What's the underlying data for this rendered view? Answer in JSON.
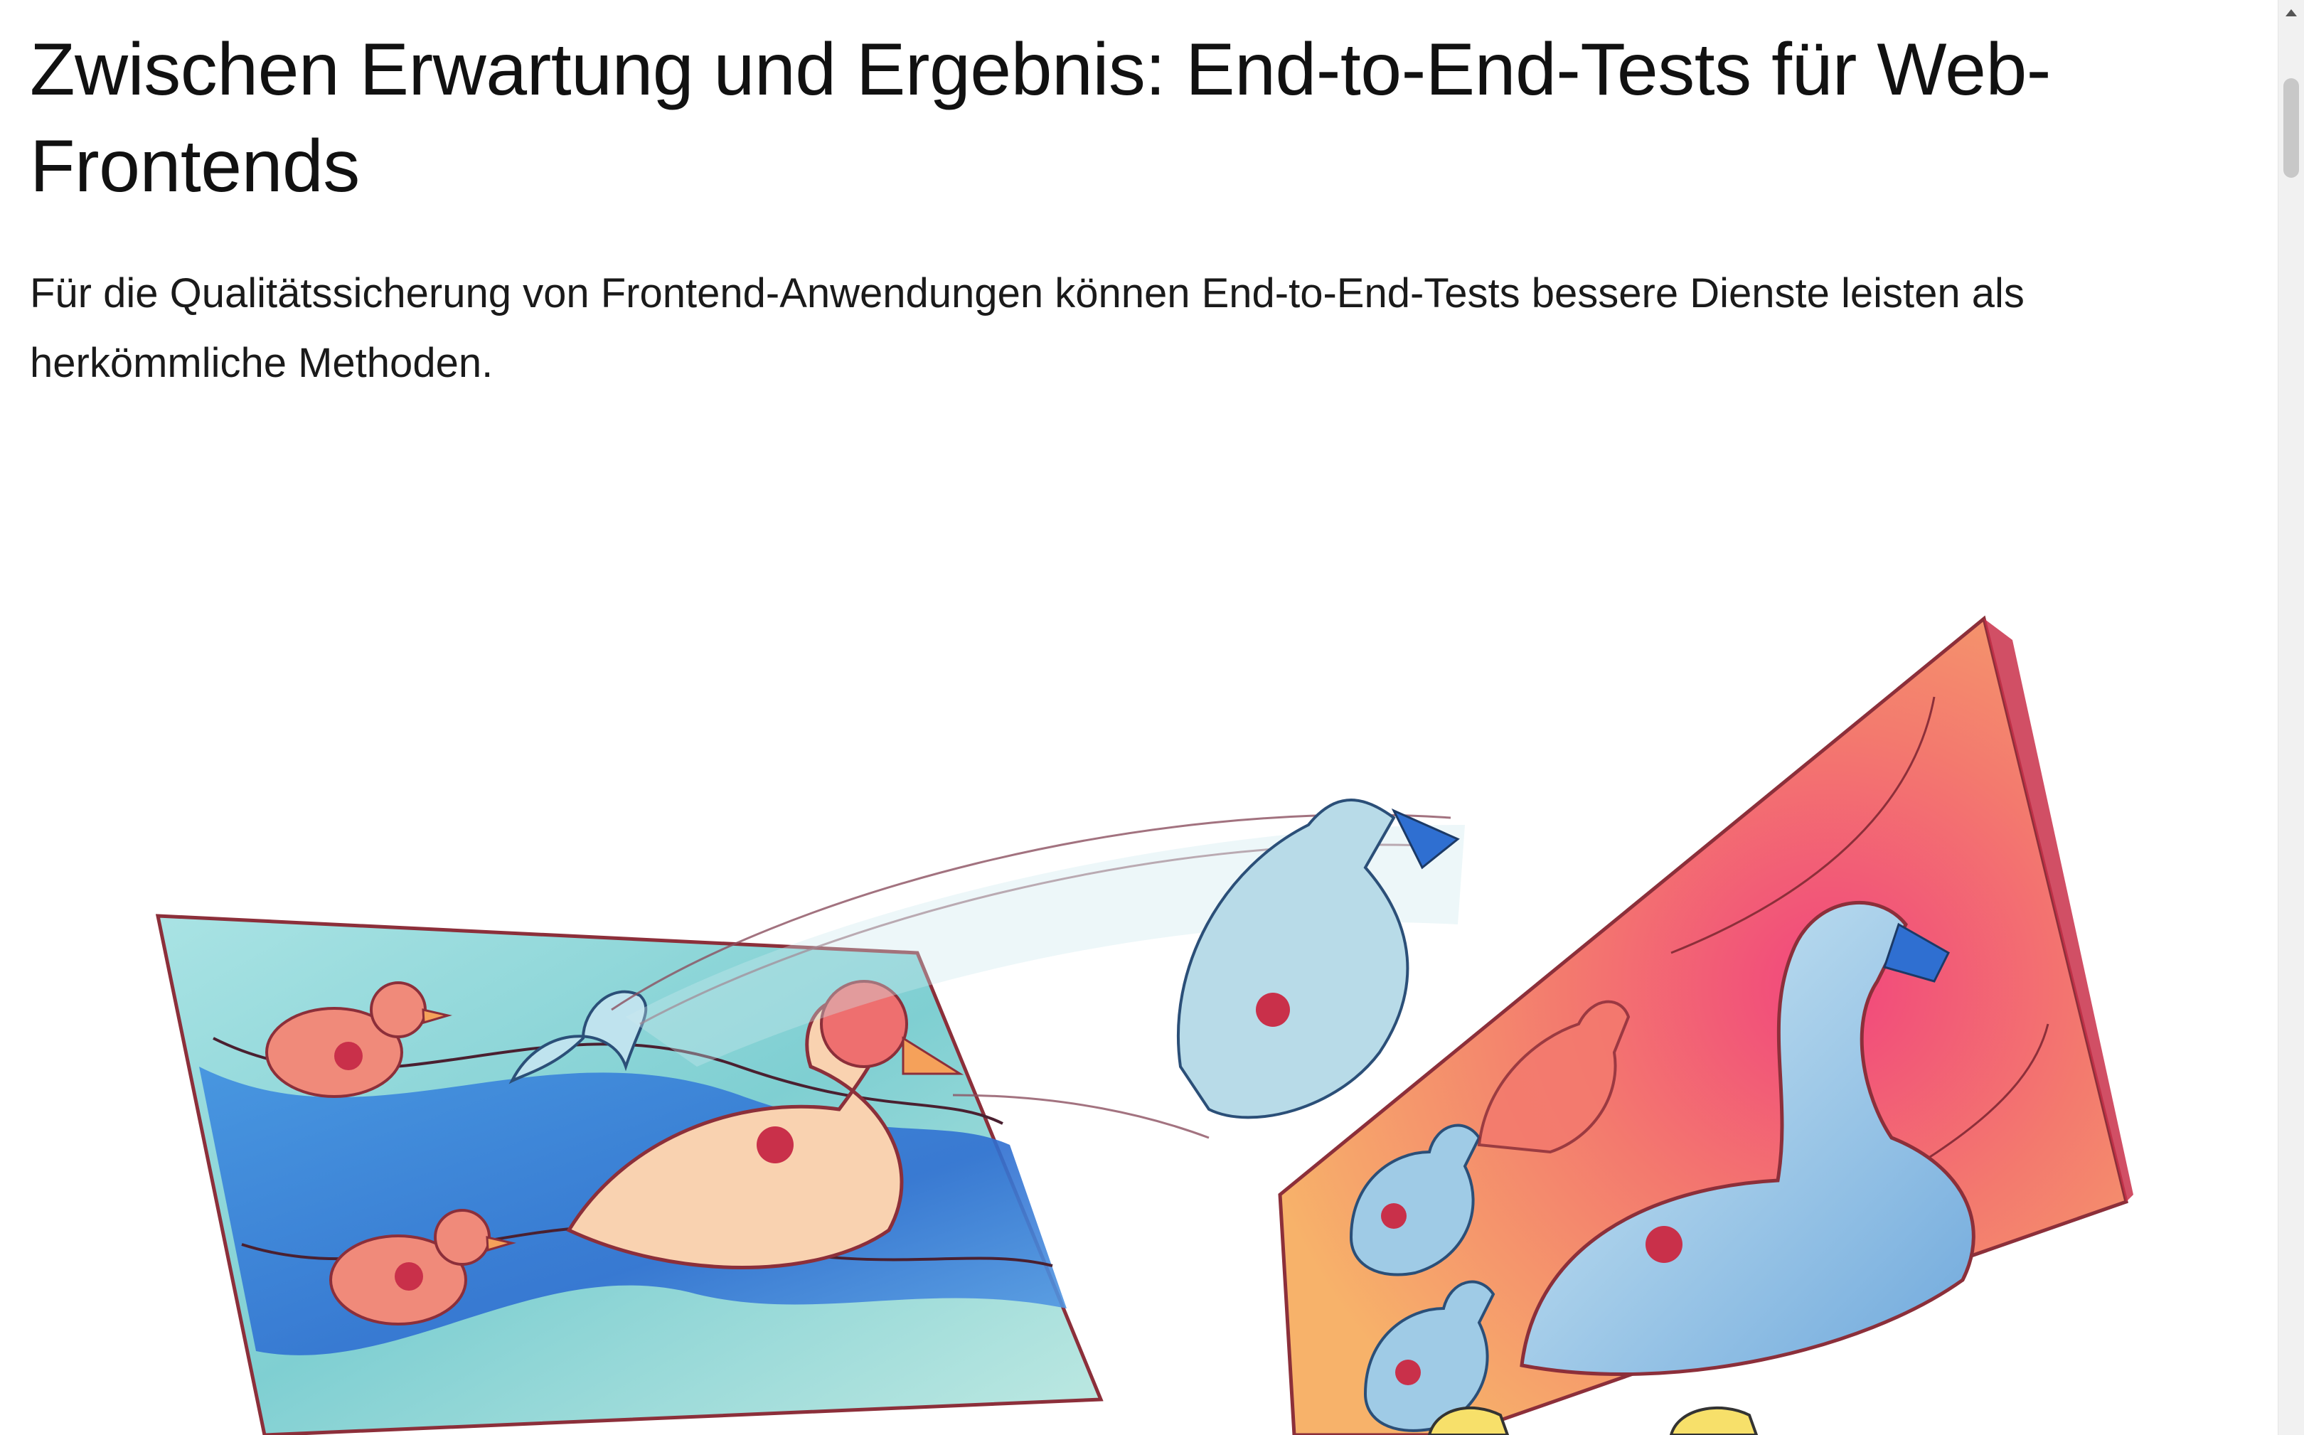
{
  "article": {
    "headline": "Zwischen Erwartung und Ergebnis: End-to-End-Tests für Web-Frontends",
    "teaser": "Für die Qualitätssicherung von Frontend-Anwendungen können End-to-End-Tests bessere Dienste leisten als herkömmliche Methoden."
  },
  "colors": {
    "text": "#111111",
    "teal": "#7fcfd2",
    "blue": "#2f6fd1",
    "coral": "#e86a6a",
    "orange": "#f5a15a",
    "pink": "#f2457d",
    "frame": "#8c2f3a"
  }
}
